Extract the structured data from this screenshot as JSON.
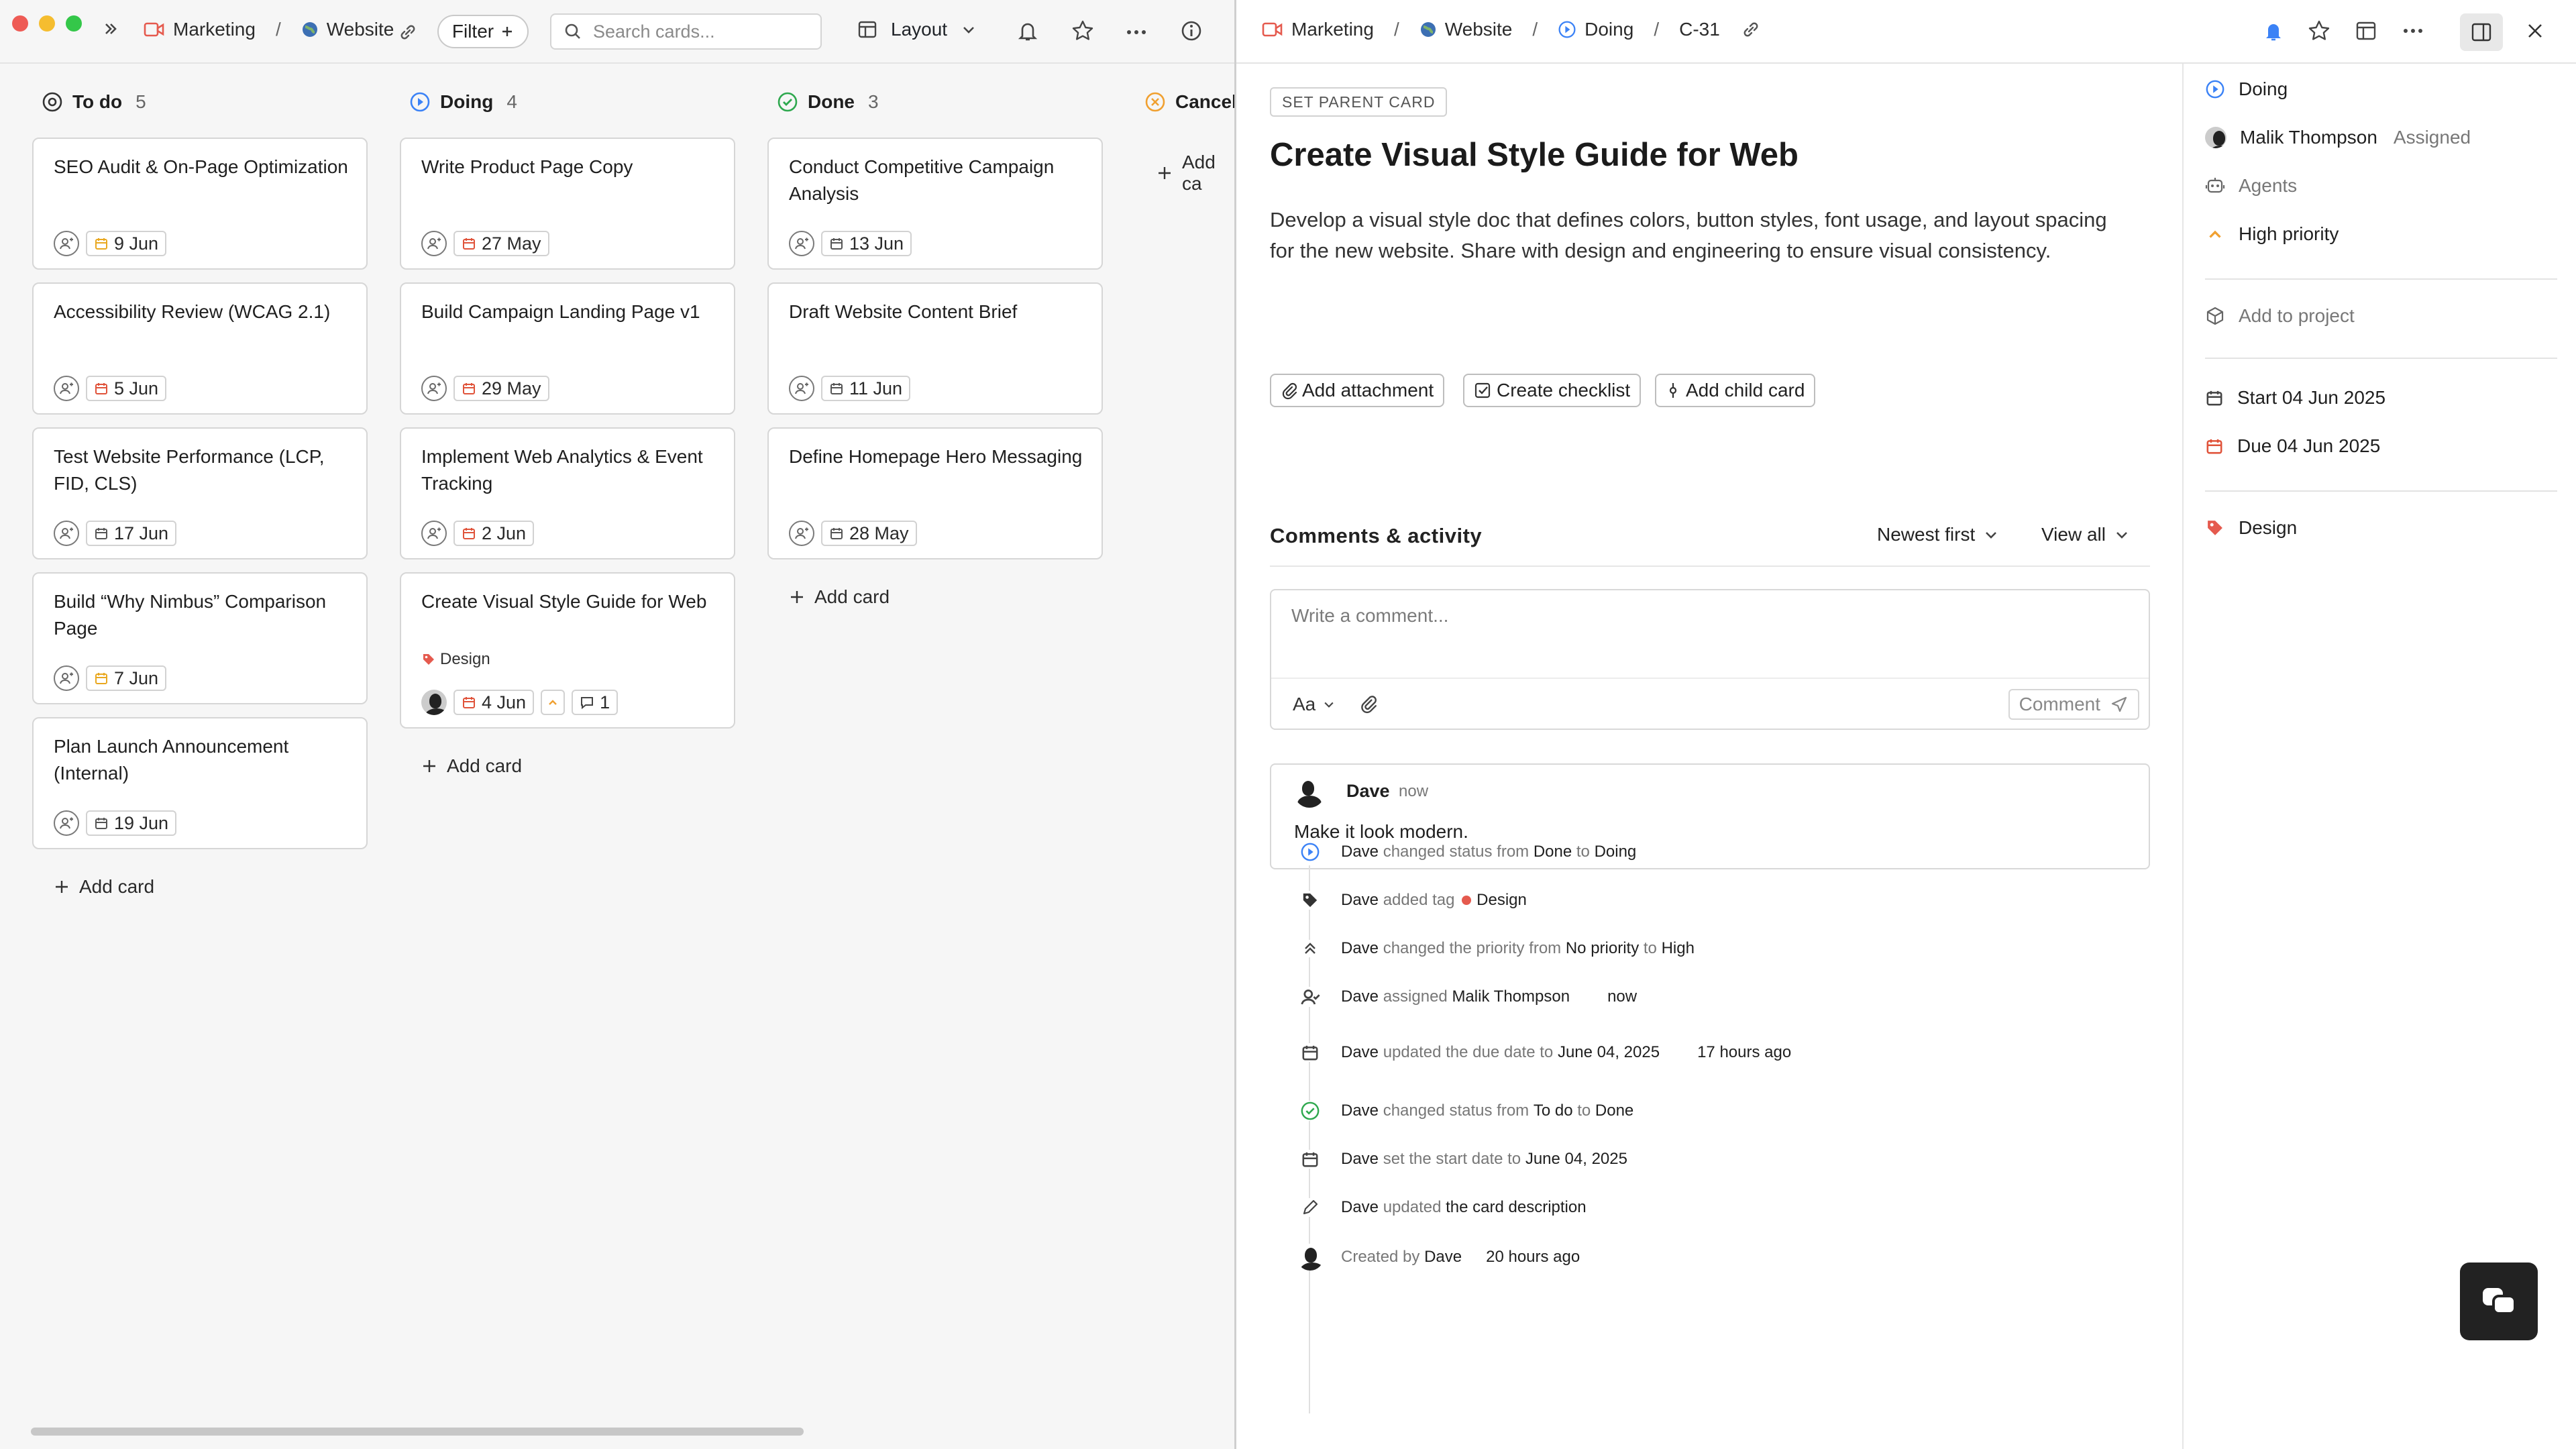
{
  "board": {
    "breadcrumb": {
      "workspace": "Marketing",
      "project": "Website"
    },
    "filter_label": "Filter",
    "search": {
      "placeholder": "Search cards..."
    },
    "layout_label": "Layout",
    "columns": [
      {
        "title": "To do",
        "count": "5",
        "add_label": "Add card",
        "cards": [
          {
            "title": "SEO Audit & On-Page Optimization",
            "date": "9 Jun",
            "date_color": "#e9a820"
          },
          {
            "title": "Accessibility Review (WCAG 2.1)",
            "date": "5 Jun",
            "date_color": "#e0533a"
          },
          {
            "title": "Test Website Performance (LCP, FID, CLS)",
            "date": "17 Jun",
            "date_color": "#555555"
          },
          {
            "title": "Build “Why Nimbus” Comparison Page",
            "date": "7 Jun",
            "date_color": "#e9a820"
          },
          {
            "title": "Plan Launch Announcement (Internal)",
            "date": "19 Jun",
            "date_color": "#555555"
          }
        ]
      },
      {
        "title": "Doing",
        "count": "4",
        "add_label": "Add card",
        "cards": [
          {
            "title": "Write Product Page Copy",
            "date": "27 May",
            "date_color": "#e0533a"
          },
          {
            "title": "Build Campaign Landing Page v1",
            "date": "29 May",
            "date_color": "#e0533a"
          },
          {
            "title": "Implement Web Analytics & Event Tracking",
            "date": "2 Jun",
            "date_color": "#e0533a"
          },
          {
            "title": "Create Visual Style Guide for Web",
            "date": "4 Jun",
            "date_color": "#e0533a",
            "tag": "Design",
            "comments": "1"
          }
        ]
      },
      {
        "title": "Done",
        "count": "3",
        "add_label": "Add card",
        "cards": [
          {
            "title": "Conduct Competitive Campaign Analysis",
            "date": "13 Jun",
            "date_color": "#555555"
          },
          {
            "title": "Draft Website Content Brief",
            "date": "11 Jun",
            "date_color": "#555555"
          },
          {
            "title": "Define Homepage Hero Messaging",
            "date": "28 May",
            "date_color": "#555555"
          }
        ]
      },
      {
        "title": "Cancel",
        "add_label": "Add ca"
      }
    ]
  },
  "detail": {
    "breadcrumb": {
      "workspace": "Marketing",
      "project": "Website",
      "status": "Doing",
      "id": "C-31"
    },
    "parent_label": "SET PARENT CARD",
    "title": "Create Visual Style Guide for Web",
    "description": "Develop a visual style doc that defines colors, button styles, font usage, and layout spacing for the new website. Share with design and engineering to ensure visual consistency.",
    "actions": {
      "attachment": "Add attachment",
      "checklist": "Create checklist",
      "child": "Add child card"
    },
    "activity_title": "Comments & activity",
    "sort_label": "Newest first",
    "view_label": "View all",
    "comment_input": {
      "placeholder": "Write a comment...",
      "format_label": "Aa",
      "submit_label": "Comment"
    },
    "comment": {
      "author": "Dave",
      "time": "now",
      "text": "Make it look modern."
    },
    "activity": [
      {
        "icon": "status-doing-icon",
        "parts": [
          "Dave",
          " changed status from ",
          "Done",
          " to ",
          "Doing"
        ]
      },
      {
        "icon": "tag-icon",
        "parts": [
          "Dave",
          " added tag ",
          "Design"
        ]
      },
      {
        "icon": "priority-up-icon",
        "parts": [
          "Dave",
          " changed the priority from ",
          "No priority",
          " to ",
          "High"
        ]
      },
      {
        "icon": "user-assign-icon",
        "parts": [
          "Dave",
          " assigned ",
          "Malik Thompson",
          "now"
        ]
      },
      {
        "icon": "calendar-icon",
        "parts": [
          "Dave",
          " updated the due date to ",
          "June 04, 2025",
          "17 hours ago"
        ]
      },
      {
        "icon": "status-done-icon",
        "parts": [
          "Dave",
          " changed status from ",
          "To do",
          " to ",
          "Done"
        ]
      },
      {
        "icon": "calendar-icon",
        "parts": [
          "Dave",
          " set the start date to ",
          "June 04, 2025"
        ]
      },
      {
        "icon": "pencil-icon",
        "parts": [
          "Dave",
          " updated ",
          "the card description"
        ]
      },
      {
        "icon": "avatar",
        "parts": [
          "Created by ",
          "Dave",
          "20 hours ago"
        ]
      }
    ],
    "side": {
      "status": "Doing",
      "assignee": "Malik Thompson",
      "assignee_role": "Assigned",
      "agents": "Agents",
      "priority": "High priority",
      "project": "Add to project",
      "start": "Start 04 Jun 2025",
      "due": "Due 04 Jun 2025",
      "tag": "Design"
    },
    "colors": {
      "accent": "#3b82f6",
      "priority": "#f0a030",
      "tag": "#e55a4e",
      "done": "#2ea84e"
    }
  }
}
